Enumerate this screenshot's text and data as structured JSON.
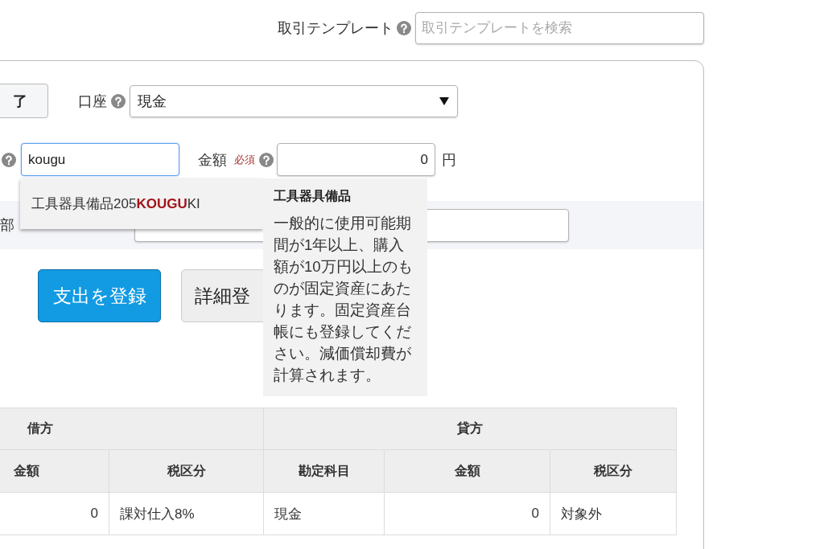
{
  "template": {
    "label": "取引テンプレート",
    "placeholder": "取引テンプレートを検索"
  },
  "form": {
    "complete_button": "了",
    "account": {
      "label": "口座",
      "value": "現金"
    },
    "item_field": {
      "value": "kougu",
      "focused": true
    },
    "amount": {
      "label": "金額",
      "required": "必須",
      "value": "0",
      "unit": "円"
    },
    "row_3": {
      "label": "部"
    }
  },
  "suggestions": [
    {
      "text": "工具器具備品205**KOUGU**KI"
    }
  ],
  "tooltip": {
    "title": "工具器具備品",
    "body": "一般的に使用可能期間が1年以上、購入額が10万円以上のものが固定資産にあたります。固定資産台帳にも登録してください。減価償却費が計算されます。"
  },
  "buttons": [
    {
      "label": "支出を登録",
      "kind": "primary"
    },
    {
      "label": "詳細登",
      "kind": "default"
    }
  ],
  "journal_table": {
    "groups": [
      {
        "label": "借方",
        "columns": [
          {
            "label": "金額",
            "kind": "amount"
          },
          {
            "label": "税区分",
            "kind": "text"
          }
        ]
      },
      {
        "label": "貸方",
        "columns": [
          {
            "label": "勘定科目",
            "kind": "text"
          },
          {
            "label": "金額",
            "kind": "amount"
          },
          {
            "label": "税区分",
            "kind": "text"
          }
        ]
      }
    ],
    "rows": [
      [
        "0",
        "課対仕入8%",
        "現金",
        "0",
        "対象外"
      ]
    ]
  }
}
